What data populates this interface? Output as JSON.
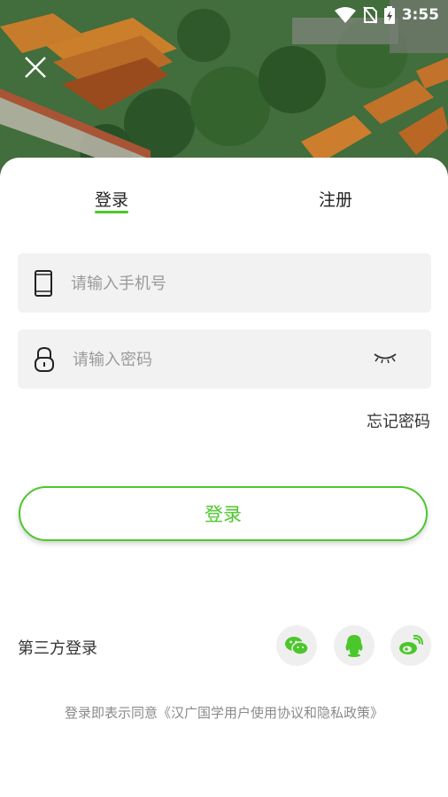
{
  "status_bar": {
    "time": "3:55"
  },
  "tabs": {
    "login": "登录",
    "register": "注册"
  },
  "phone": {
    "placeholder": "请输入手机号"
  },
  "password": {
    "placeholder": "请输入密码"
  },
  "forgot_password": "忘记密码",
  "login_button": "登录",
  "third_party": {
    "label": "第三方登录",
    "providers": [
      "wechat",
      "qq",
      "weibo"
    ]
  },
  "agreement": "登录即表示同意《汉广国学用户使用协议和隐私政策》",
  "colors": {
    "accent": "#4cc72b",
    "field_bg": "#f2f2f2"
  },
  "icons": [
    "wifi-icon",
    "no-sim-icon",
    "battery-charging-icon",
    "close-icon",
    "phone-icon",
    "lock-icon",
    "eye-closed-icon",
    "wechat-icon",
    "qq-icon",
    "weibo-icon"
  ]
}
